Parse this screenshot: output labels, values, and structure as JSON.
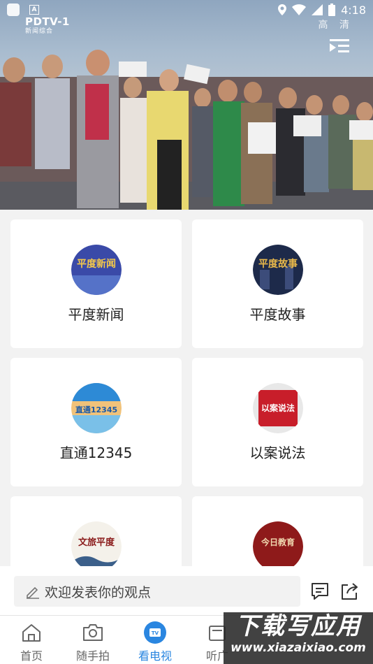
{
  "status_bar": {
    "time": "4:18"
  },
  "video": {
    "channel_logo": "PDTV-1",
    "channel_sub": "新闻综合",
    "quality": "高 清"
  },
  "programs": [
    {
      "label": "平度新闻",
      "thumb_text": "平度新闻",
      "thumb_colors": [
        "#3a4aa8",
        "#d7b04a"
      ]
    },
    {
      "label": "平度故事",
      "thumb_text": "平度故事",
      "thumb_colors": [
        "#1d2a4a",
        "#d8a540"
      ]
    },
    {
      "label": "直通12345",
      "thumb_text": "直通12345",
      "thumb_colors": [
        "#2d8ad6",
        "#f0c27a"
      ]
    },
    {
      "label": "以案说法",
      "thumb_text": "以案说法",
      "thumb_colors": [
        "#c81e2a",
        "#f0f0f0"
      ]
    },
    {
      "label": "",
      "thumb_text": "文旅平度",
      "thumb_colors": [
        "#f4f1ea",
        "#3b5f8a"
      ]
    },
    {
      "label": "",
      "thumb_text": "今日教育",
      "thumb_colors": [
        "#8e1a1a",
        "#e8c9a0"
      ]
    }
  ],
  "comment": {
    "placeholder": "欢迎发表你的观点"
  },
  "tabs": [
    {
      "label": "首页"
    },
    {
      "label": "随手拍"
    },
    {
      "label": "看电视"
    },
    {
      "label": "听广"
    }
  ],
  "watermark": {
    "title": "下载写应用",
    "url": "www.xiazaixiao.com"
  },
  "colors": {
    "accent": "#2a86e0",
    "background": "#f2f2f2"
  }
}
